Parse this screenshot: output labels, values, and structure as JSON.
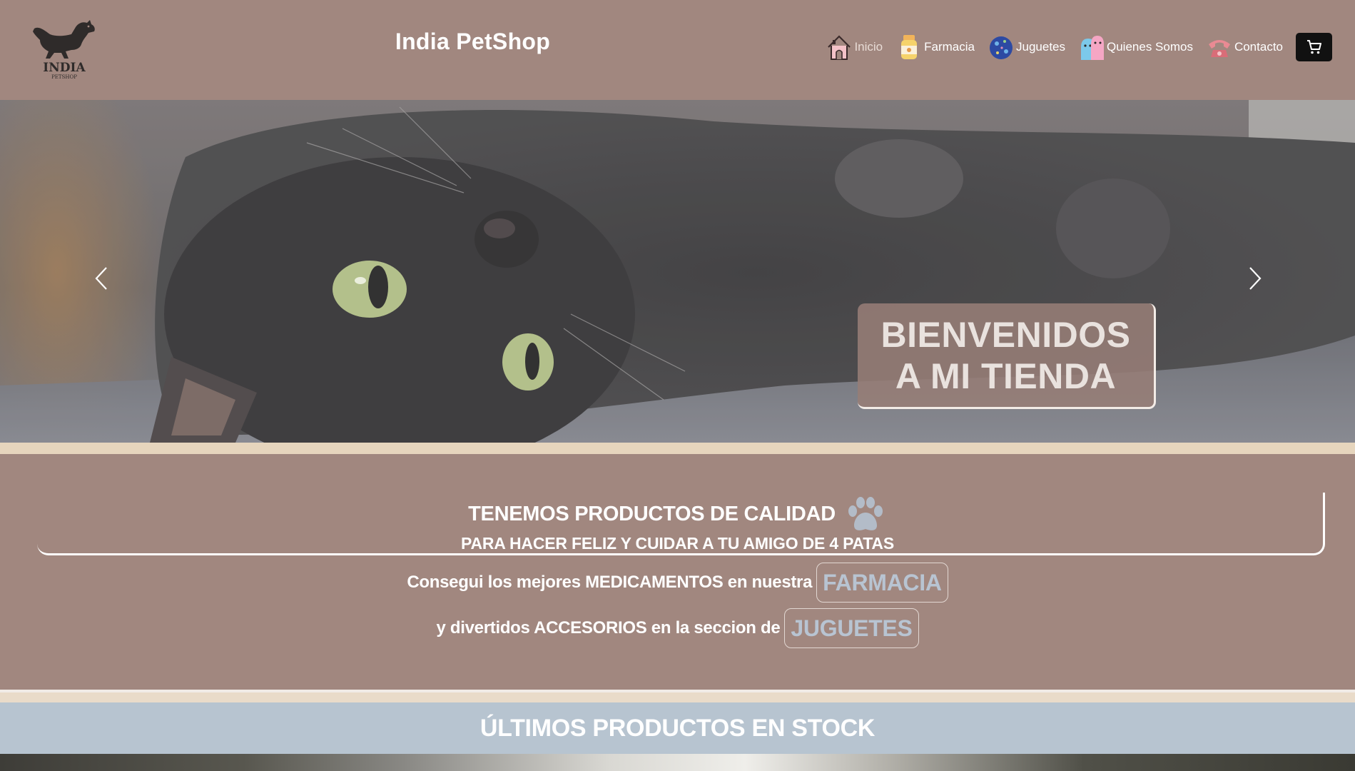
{
  "header": {
    "site_title": "India PetShop",
    "logo": {
      "icon": "dog-logo-icon",
      "text_main": "INDIA",
      "text_sub": "PETSHOP"
    },
    "nav": [
      {
        "label": "Inicio",
        "icon": "house-icon"
      },
      {
        "label": "Farmacia",
        "icon": "medicine-bottle-icon"
      },
      {
        "label": "Juguetes",
        "icon": "ball-icon"
      },
      {
        "label": "Quienes Somos",
        "icon": "pets-group-icon"
      },
      {
        "label": "Contacto",
        "icon": "telephone-icon"
      }
    ],
    "cart_icon": "cart-icon"
  },
  "hero": {
    "caption": "BIENVENIDOS A MI TIENDA",
    "prev_icon": "chevron-left-icon",
    "next_icon": "chevron-right-icon"
  },
  "quality": {
    "heading": "TENEMOS PRODUCTOS DE CALIDAD",
    "subheading": "PARA HACER FELIZ Y CUIDAR A TU AMIGO DE 4 PATAS",
    "paw_icon": "paw-icon",
    "promo_pharmacy_text": "Consegui los mejores MEDICAMENTOS en nuestra",
    "promo_pharmacy_button": "FARMACIA",
    "promo_toys_text": "y divertidos ACCESORIOS en la seccion de",
    "promo_toys_button": "JUGUETES"
  },
  "products": {
    "title": "ÚLTIMOS PRODUCTOS EN STOCK"
  },
  "colors": {
    "background": "#a1877f",
    "cream_stripe": "#e6d5bd",
    "products_band": "#b7c4d0",
    "pill_text": "#b8c4d2",
    "cart_button": "#111111"
  }
}
